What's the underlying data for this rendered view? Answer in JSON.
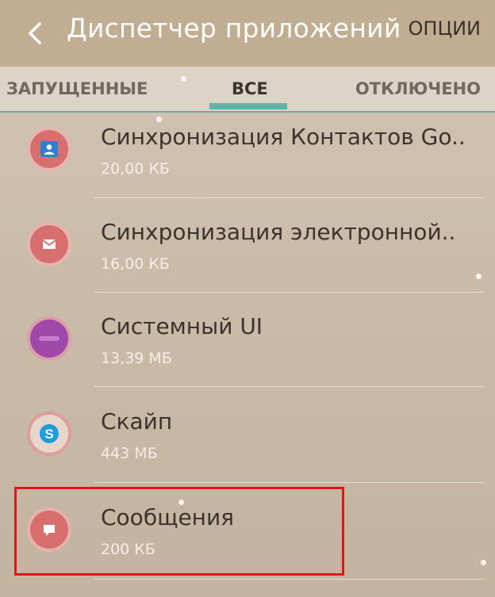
{
  "header": {
    "title": "Диспетчер приложений",
    "options_label": "ОПЦИИ"
  },
  "tabs": [
    {
      "label": "ЗАПУЩЕННЫЕ",
      "selected": false
    },
    {
      "label": "ВСЕ",
      "selected": true
    },
    {
      "label": "ОТКЛЮЧЕНО",
      "selected": false
    }
  ],
  "apps": [
    {
      "name": "Синхронизация Контактов Go..",
      "size": "20,00 КБ",
      "icon": "contacts-sync-icon"
    },
    {
      "name": "Синхронизация электронной..",
      "size": "16,00 КБ",
      "icon": "email-sync-icon"
    },
    {
      "name": "Системный UI",
      "size": "13,39 МБ",
      "icon": "system-ui-icon"
    },
    {
      "name": "Скайп",
      "size": "443 МБ",
      "icon": "skype-icon"
    },
    {
      "name": "Сообщения",
      "size": "200 КБ",
      "icon": "messages-icon",
      "highlighted": true
    }
  ],
  "colors": {
    "accent": "#62b3a7",
    "header": "#c1ad92",
    "highlight": "#e0151a"
  }
}
